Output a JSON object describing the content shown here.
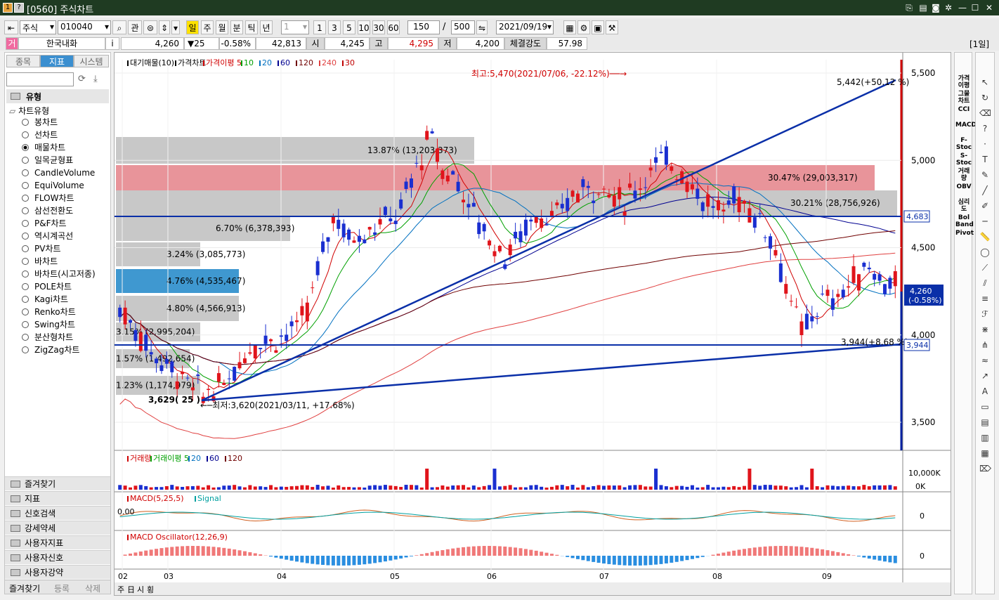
{
  "window": {
    "code": "1",
    "help": "?",
    "title": "[0560] 주식차트"
  },
  "toolbar": {
    "market": "주식",
    "code": "010040",
    "group": "관",
    "periods": [
      "일",
      "주",
      "월",
      "분",
      "틱",
      "년"
    ],
    "interval_sel": "1",
    "intervals": [
      "1",
      "3",
      "5",
      "10",
      "30",
      "60"
    ],
    "count": "150",
    "total": "500",
    "date": "2021/09/19"
  },
  "quote": {
    "tag": "거",
    "name": "한국내화",
    "price": "4,260",
    "change": "▼25",
    "rate": "-0.58%",
    "volume": "42,813",
    "open_label": "시",
    "open": "4,245",
    "high_label": "고",
    "high": "4,295",
    "low_label": "저",
    "low": "4,200",
    "strength_label": "체결강도",
    "strength": "57.98",
    "period": "[1일]"
  },
  "left_panel": {
    "tabs": [
      "종목",
      "지표",
      "시스템"
    ],
    "section": "유형",
    "category": "차트유형",
    "chart_types": [
      "봉차트",
      "선차트",
      "매물차트",
      "일목균형표",
      "CandleVolume",
      "EquiVolume",
      "FLOW차트",
      "삼선전환도",
      "P&F차트",
      "역시계곡선",
      "PV차트",
      "바차트",
      "바차트(시고저종)",
      "POLE차트",
      "Kagi차트",
      "Renko차트",
      "Swing차트",
      "분산형차트",
      "ZigZag차트"
    ],
    "selected": "매물차트",
    "folders": [
      "즐겨찾기",
      "지표",
      "신호검색",
      "강세약세",
      "사용자지표",
      "사용자신호",
      "사용자강약"
    ],
    "footer_tabs": [
      "즐겨찾기",
      "등록",
      "삭제"
    ]
  },
  "price_panel": {
    "legend": [
      {
        "text": "대기매물(10)",
        "color": "#000000"
      },
      {
        "text": "가격차트",
        "color": "#000000"
      },
      {
        "text": "가격이평 5",
        "color": "#d00000"
      },
      {
        "text": "10",
        "color": "#00a000"
      },
      {
        "text": "20",
        "color": "#0070c0"
      },
      {
        "text": "60",
        "color": "#000090"
      },
      {
        "text": "120",
        "color": "#700000"
      },
      {
        "text": "240",
        "color": "#e04040"
      },
      {
        "text": "30",
        "color": "#c00000"
      }
    ],
    "y_ticks": [
      "5,500",
      "5,000",
      "4,500",
      "4,000",
      "3,500"
    ],
    "last_price_tag": [
      "4,260",
      "(-0.58%)"
    ],
    "line_tags": [
      "4,683",
      "3,944"
    ],
    "annotations": {
      "high": "최고:5,470(2021/07/06, -22.12%)──→",
      "low": "←─최저:3,620(2021/03/11, +17.68%)",
      "trend_up": "5,442(+50.12 %)",
      "trend_low": "3,944(+8.68 %)",
      "low_label": "3,629( 25 )"
    },
    "volume_profile": [
      "1.23% (1,174,979)",
      "1.57% (1,492,654)",
      "3.15% (2,995,204)",
      "4.80% (4,566,913)",
      "4.76% (4,535,467)",
      "3.24% (3,085,773)",
      "6.70% (6,378,393)",
      "30.21% (28,756,926)",
      "30.47% (29,003,317)",
      "13.87% (13,203,373)"
    ]
  },
  "volume_panel": {
    "legend": [
      {
        "text": "거래량",
        "color": "#d00000"
      },
      {
        "text": "거래이평 5",
        "color": "#00a000"
      },
      {
        "text": "20",
        "color": "#0070c0"
      },
      {
        "text": "60",
        "color": "#000090"
      },
      {
        "text": "120",
        "color": "#700000"
      }
    ],
    "y_ticks": [
      "10,000K",
      "0K"
    ]
  },
  "macd_panel": {
    "legend": [
      {
        "text": "MACD(5,25,5)",
        "color": "#d00000"
      },
      {
        "text": "Signal",
        "color": "#00a0a0"
      }
    ],
    "y_tick": "0",
    "zero_label": "0.00"
  },
  "osc_panel": {
    "legend": [
      {
        "text": "MACD Oscillator(12,26,9)",
        "color": "#d00000"
      }
    ],
    "y_tick": "0"
  },
  "x_axis": [
    "02",
    "03",
    "04",
    "05",
    "06",
    "07",
    "08",
    "09"
  ],
  "bottom_tabs": [
    "주",
    "日",
    "시",
    "횡"
  ],
  "right_indicators": [
    "가격이평",
    "그물차트",
    "CCI",
    "MACD",
    "F-Stoc",
    "S-Stoc",
    "거래량",
    "OBV",
    "심리도",
    "Bol Band",
    "Pivot"
  ]
}
